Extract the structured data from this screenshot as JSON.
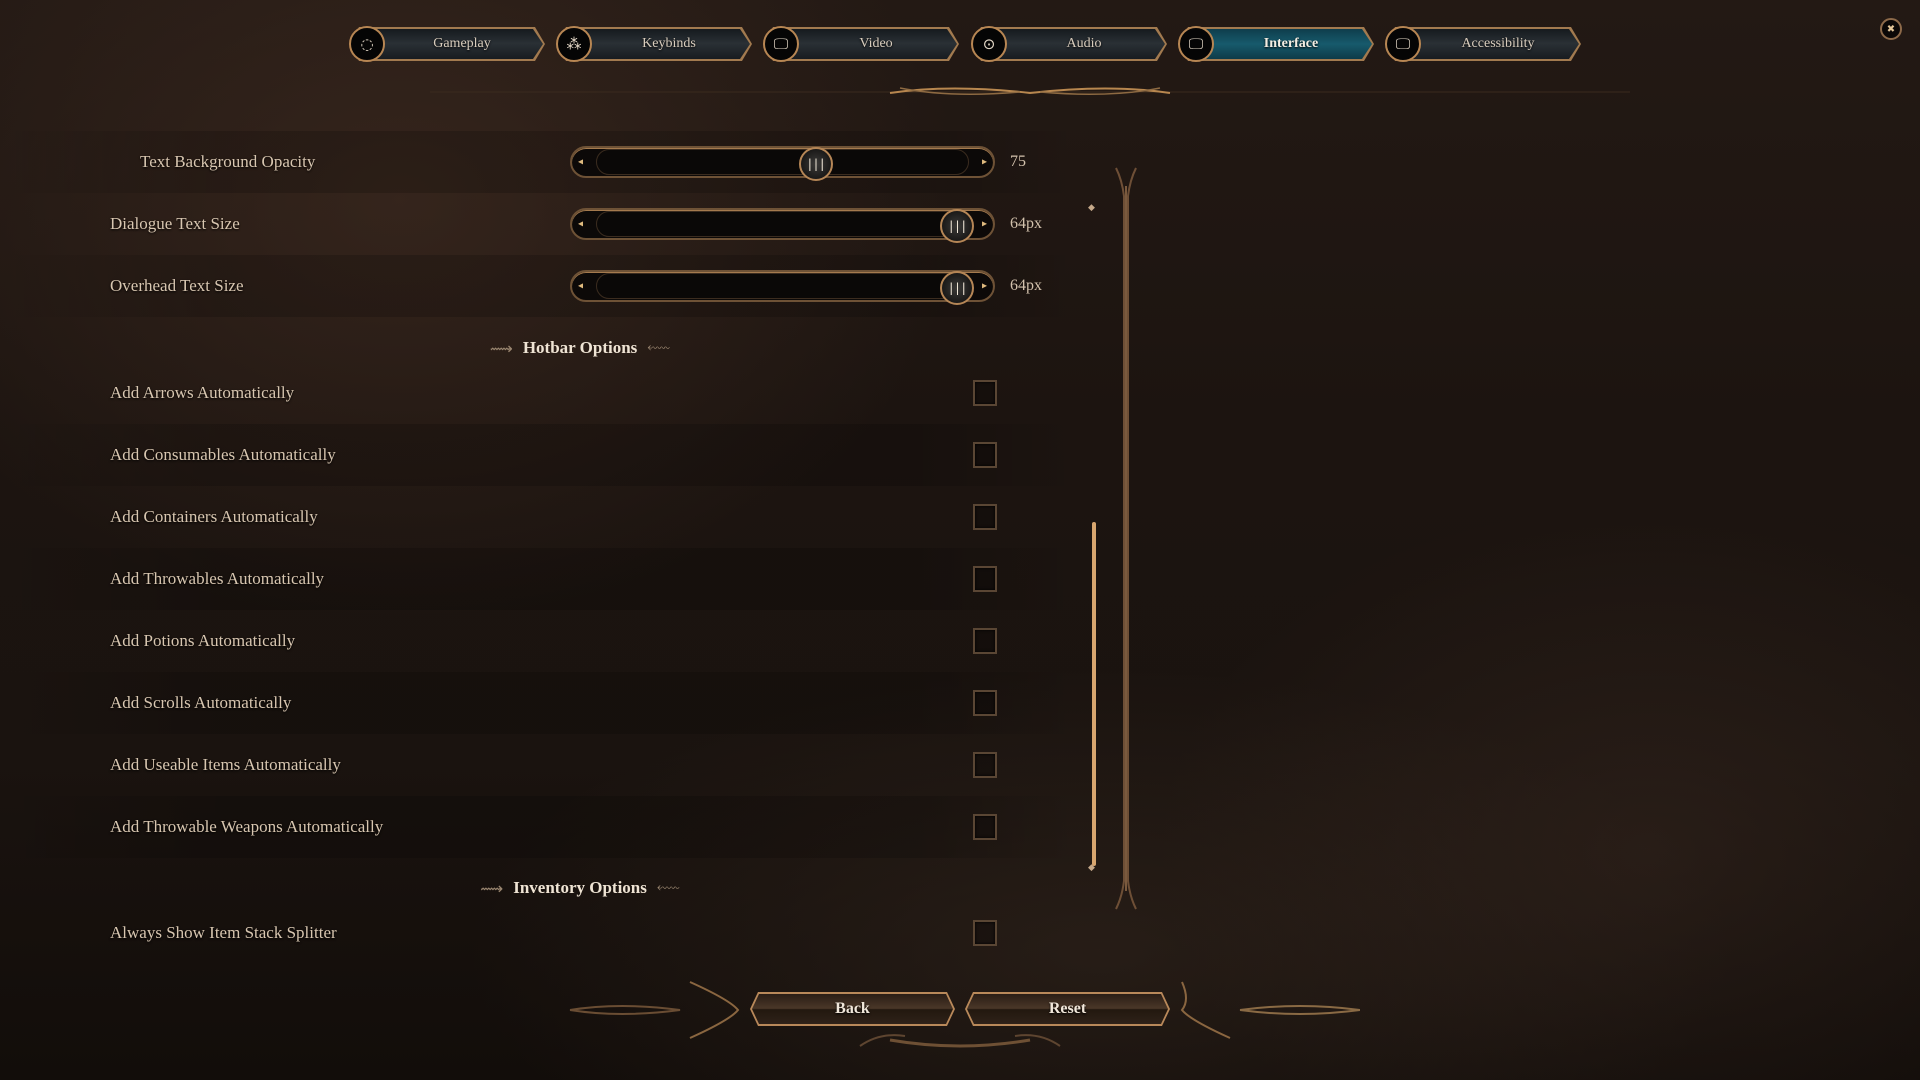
{
  "tabs": [
    {
      "label": "Gameplay",
      "icon": "gameplay-cycle-icon",
      "glyph": "◌",
      "active": false
    },
    {
      "label": "Keybinds",
      "icon": "keybinds-keys-icon",
      "glyph": "⁂",
      "active": false
    },
    {
      "label": "Video",
      "icon": "monitor-icon",
      "glyph": "🖵",
      "active": false
    },
    {
      "label": "Audio",
      "icon": "speaker-icon",
      "glyph": "⊙",
      "active": false
    },
    {
      "label": "Interface",
      "icon": "monitor-icon",
      "glyph": "🖵",
      "active": true
    },
    {
      "label": "Accessibility",
      "icon": "monitor-icon",
      "glyph": "🖵",
      "active": false
    }
  ],
  "close_glyph": "✖",
  "sliders": [
    {
      "label": "Text Background Opacity",
      "value_text": "75",
      "fraction": 0.59
    },
    {
      "label": "Dialogue Text Size",
      "value_text": "64px",
      "fraction": 1.0
    },
    {
      "label": "Overhead Text Size",
      "value_text": "64px",
      "fraction": 1.0
    }
  ],
  "slider_glyphs": {
    "left": "◂",
    "right": "▸",
    "thumb": "|||"
  },
  "sections": {
    "hotbar": {
      "title": "Hotbar Options",
      "items": [
        {
          "label": "Add Arrows Automatically",
          "checked": false
        },
        {
          "label": "Add Consumables Automatically",
          "checked": false
        },
        {
          "label": "Add Containers Automatically",
          "checked": false
        },
        {
          "label": "Add Throwables Automatically",
          "checked": false
        },
        {
          "label": "Add Potions Automatically",
          "checked": false
        },
        {
          "label": "Add Scrolls Automatically",
          "checked": false
        },
        {
          "label": "Add Useable Items Automatically",
          "checked": false
        },
        {
          "label": "Add Throwable Weapons Automatically",
          "checked": false
        }
      ]
    },
    "inventory": {
      "title": "Inventory Options",
      "items": [
        {
          "label": "Always Show Item Stack Splitter",
          "checked": false
        }
      ]
    }
  },
  "flourish": {
    "left": "⟿",
    "right": "⬳"
  },
  "scrollbar": {
    "position_fraction": 0.62,
    "visible_fraction": 0.52,
    "up_glyph": "◆",
    "down_glyph": "◆"
  },
  "buttons": {
    "back": "Back",
    "reset": "Reset"
  }
}
